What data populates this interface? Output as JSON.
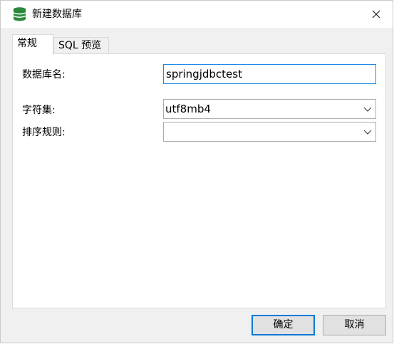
{
  "window": {
    "title": "新建数据库",
    "icon": "database-icon"
  },
  "tabs": [
    {
      "label": "常规",
      "active": true
    },
    {
      "label": "SQL 预览",
      "active": false
    }
  ],
  "form": {
    "db_name_label": "数据库名:",
    "db_name_value": "springjdbctest",
    "charset_label": "字符集:",
    "charset_value": "utf8mb4",
    "collation_label": "排序规则:",
    "collation_value": ""
  },
  "buttons": {
    "ok_label": "确定",
    "cancel_label": "取消"
  },
  "colors": {
    "accent": "#0078d7",
    "icon_green": "#2e8b3e",
    "window_bg": "#f0f0f0"
  }
}
